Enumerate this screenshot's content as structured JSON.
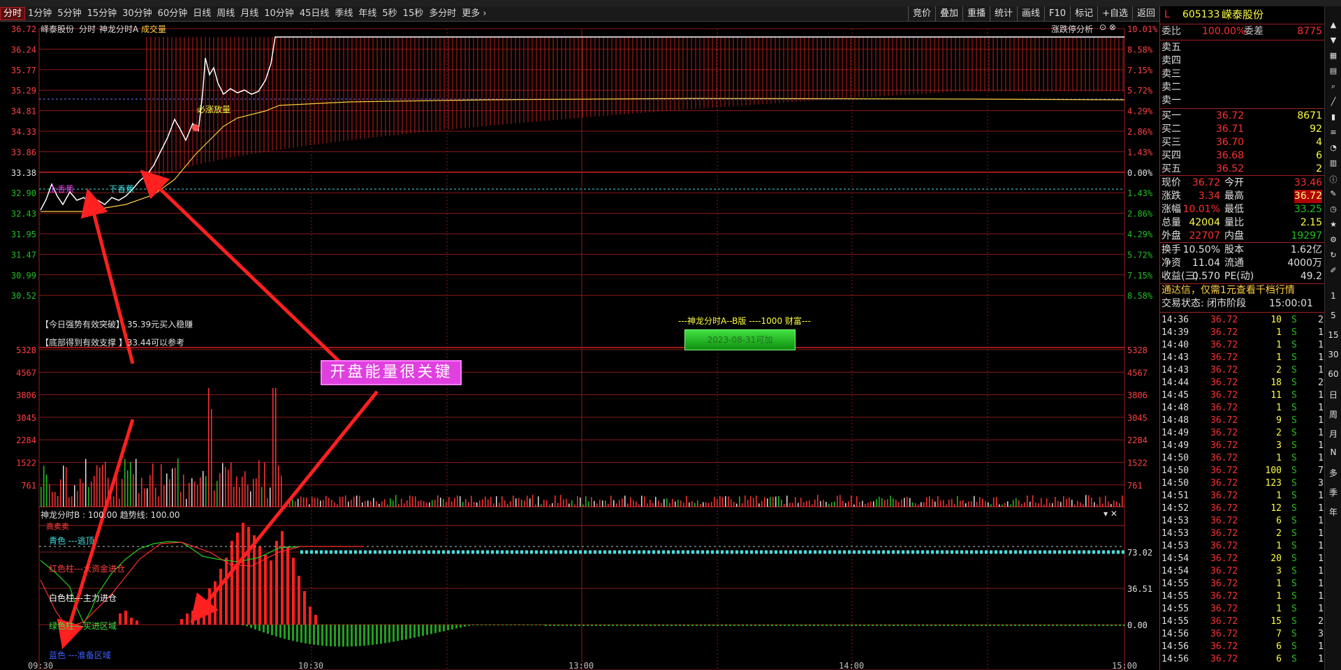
{
  "toolbar": {
    "periods": [
      "分时",
      "1分钟",
      "5分钟",
      "15分钟",
      "30分钟",
      "60分钟",
      "日线",
      "周线",
      "月线",
      "10分钟",
      "45日线",
      "季线",
      "年线",
      "5秒",
      "15秒",
      "多分时",
      "更多 ›"
    ],
    "tools": [
      "竞价",
      "叠加",
      "重播",
      "统计",
      "画线",
      "F10",
      "标记",
      "+自选",
      "返回"
    ]
  },
  "main_chart": {
    "stock_name": "峄泰股份",
    "mode": "分时",
    "indicator": "神龙分时A",
    "volume_label": "成交量",
    "limit_btn": "涨跌停分析",
    "price_ticks": [
      "36.72",
      "36.24",
      "35.77",
      "35.29",
      "34.81",
      "34.33",
      "33.86",
      "33.38",
      "32.90",
      "32.43",
      "31.95",
      "31.47",
      "30.99",
      "30.52"
    ],
    "pct_ticks": [
      "10.01%",
      "8.58%",
      "7.15%",
      "5.72%",
      "4.29%",
      "2.86%",
      "1.43%",
      "0.00%",
      "1.43%",
      "2.86%",
      "4.29%",
      "5.72%",
      "7.15%",
      "8.58%"
    ],
    "annot_breakout": "必涨放量",
    "annot_up": "上香蕉",
    "annot_down": "下香蕉",
    "note1": "【今日强势有效突破】 35.39元买入稳赚",
    "note2": "【底部得到有效支撑 】33.44可以参考",
    "promo": "---神龙分时A--B版 ----1000 财富---",
    "promo_btn": "2023-08-31可加",
    "volume_ticks": [
      "5328",
      "4567",
      "3806",
      "3045",
      "2284",
      "1522",
      "761"
    ]
  },
  "sub_chart": {
    "title": "神龙分时B : 100.00 趋势线: 100.00",
    "ticks": [
      "73.02",
      "36.51",
      "0.00"
    ],
    "label_top": "高卖卖",
    "legend": [
      "青色 ---逃顶",
      "红色柱---大资金进仓",
      "白色柱---主力进仓",
      "绿色柱---买进区域",
      "蓝色 ---准备区域"
    ]
  },
  "time_axis": [
    "09:30",
    "10:30",
    "13:00",
    "14:00",
    "15:00"
  ],
  "callout": "开盘能量很关键",
  "panel": {
    "header_flag": "L",
    "code": "605133",
    "name": "嵘泰股份",
    "weibi_label": "委比",
    "weibi": "100.00%",
    "weicha_label": "委差",
    "weicha": "8775",
    "sells": [
      "卖五",
      "卖四",
      "卖三",
      "卖二",
      "卖一"
    ],
    "buys": [
      {
        "label": "买一",
        "price": "36.72",
        "vol": "8671"
      },
      {
        "label": "买二",
        "price": "36.71",
        "vol": "92"
      },
      {
        "label": "买三",
        "price": "36.70",
        "vol": "4"
      },
      {
        "label": "买四",
        "price": "36.68",
        "vol": "6"
      },
      {
        "label": "买五",
        "price": "36.52",
        "vol": "2"
      }
    ],
    "stats": [
      {
        "l1": "现价",
        "v1": "36.72",
        "l2": "今开",
        "v2": "33.46"
      },
      {
        "l1": "涨跌",
        "v1": "3.34",
        "l2": "最高",
        "v2": "36.72"
      },
      {
        "l1": "涨幅",
        "v1": "10.01%",
        "l2": "最低",
        "v2": "33.25"
      },
      {
        "l1": "总量",
        "v1": "42004",
        "l2": "量比",
        "v2": "2.15"
      },
      {
        "l1": "外盘",
        "v1": "22707",
        "l2": "内盘",
        "v2": "19297"
      }
    ],
    "fin": [
      {
        "l1": "换手",
        "v1": "10.50%",
        "l2": "股本",
        "v2": "1.62亿"
      },
      {
        "l1": "净资",
        "v1": "11.04",
        "l2": "流通",
        "v2": "4000万"
      },
      {
        "l1": "收益(三)",
        "v1": "0.570",
        "l2": "PE(动)",
        "v2": "49.2"
      }
    ],
    "notice": "通达信，仅需1元查看千档行情",
    "trade_status": "交易状态: 闭市阶段",
    "trade_time": "15:00:01",
    "ticks": [
      {
        "t": "14:36",
        "p": "36.72",
        "v": "10",
        "s": "S",
        "n": "2"
      },
      {
        "t": "14:39",
        "p": "36.72",
        "v": "1",
        "s": "S",
        "n": "1"
      },
      {
        "t": "14:40",
        "p": "36.72",
        "v": "1",
        "s": "S",
        "n": "1"
      },
      {
        "t": "14:43",
        "p": "36.72",
        "v": "1",
        "s": "S",
        "n": "1"
      },
      {
        "t": "14:43",
        "p": "36.72",
        "v": "2",
        "s": "S",
        "n": "1"
      },
      {
        "t": "14:44",
        "p": "36.72",
        "v": "18",
        "s": "S",
        "n": "2"
      },
      {
        "t": "14:45",
        "p": "36.72",
        "v": "11",
        "s": "S",
        "n": "1"
      },
      {
        "t": "14:48",
        "p": "36.72",
        "v": "1",
        "s": "S",
        "n": "1"
      },
      {
        "t": "14:48",
        "p": "36.72",
        "v": "9",
        "s": "S",
        "n": "1"
      },
      {
        "t": "14:49",
        "p": "36.72",
        "v": "2",
        "s": "S",
        "n": "1"
      },
      {
        "t": "14:49",
        "p": "36.72",
        "v": "3",
        "s": "S",
        "n": "1"
      },
      {
        "t": "14:50",
        "p": "36.72",
        "v": "1",
        "s": "S",
        "n": "1"
      },
      {
        "t": "14:50",
        "p": "36.72",
        "v": "100",
        "s": "S",
        "n": "7"
      },
      {
        "t": "14:50",
        "p": "36.72",
        "v": "123",
        "s": "S",
        "n": "3"
      },
      {
        "t": "14:51",
        "p": "36.72",
        "v": "1",
        "s": "S",
        "n": "1"
      },
      {
        "t": "14:52",
        "p": "36.72",
        "v": "12",
        "s": "S",
        "n": "1"
      },
      {
        "t": "14:53",
        "p": "36.72",
        "v": "6",
        "s": "S",
        "n": "1"
      },
      {
        "t": "14:53",
        "p": "36.72",
        "v": "2",
        "s": "S",
        "n": "1"
      },
      {
        "t": "14:53",
        "p": "36.72",
        "v": "1",
        "s": "S",
        "n": "1"
      },
      {
        "t": "14:54",
        "p": "36.72",
        "v": "20",
        "s": "S",
        "n": "1"
      },
      {
        "t": "14:54",
        "p": "36.72",
        "v": "3",
        "s": "S",
        "n": "1"
      },
      {
        "t": "14:55",
        "p": "36.72",
        "v": "1",
        "s": "S",
        "n": "1"
      },
      {
        "t": "14:55",
        "p": "36.72",
        "v": "1",
        "s": "S",
        "n": "1"
      },
      {
        "t": "14:55",
        "p": "36.72",
        "v": "1",
        "s": "S",
        "n": "1"
      },
      {
        "t": "14:55",
        "p": "36.72",
        "v": "15",
        "s": "S",
        "n": "2"
      },
      {
        "t": "14:56",
        "p": "36.72",
        "v": "7",
        "s": "S",
        "n": "3"
      },
      {
        "t": "14:56",
        "p": "36.72",
        "v": "6",
        "s": "S",
        "n": "1"
      },
      {
        "t": "14:56",
        "p": "36.72",
        "v": "6",
        "s": "S",
        "n": "1"
      }
    ]
  },
  "side_icons": [
    "up-arrow-icon",
    "down-arrow-icon",
    "chart-icon",
    "grid-icon",
    "search-icon",
    "line-icon",
    "bar-icon",
    "list-icon",
    "pie-icon",
    "table-icon",
    "info-icon",
    "note-icon",
    "clock-icon",
    "star-icon",
    "gear-icon",
    "refresh-icon",
    "edit-icon"
  ],
  "side_labels": [
    "1",
    "5",
    "15",
    "30",
    "60",
    "日",
    "周",
    "月",
    "N",
    "多",
    "季",
    "年"
  ],
  "colors": {
    "up": "#ff3333",
    "down": "#00cc00",
    "cyan": "#40e0e0",
    "yellow": "#ffff00",
    "grid": "#8a1a1a"
  }
}
